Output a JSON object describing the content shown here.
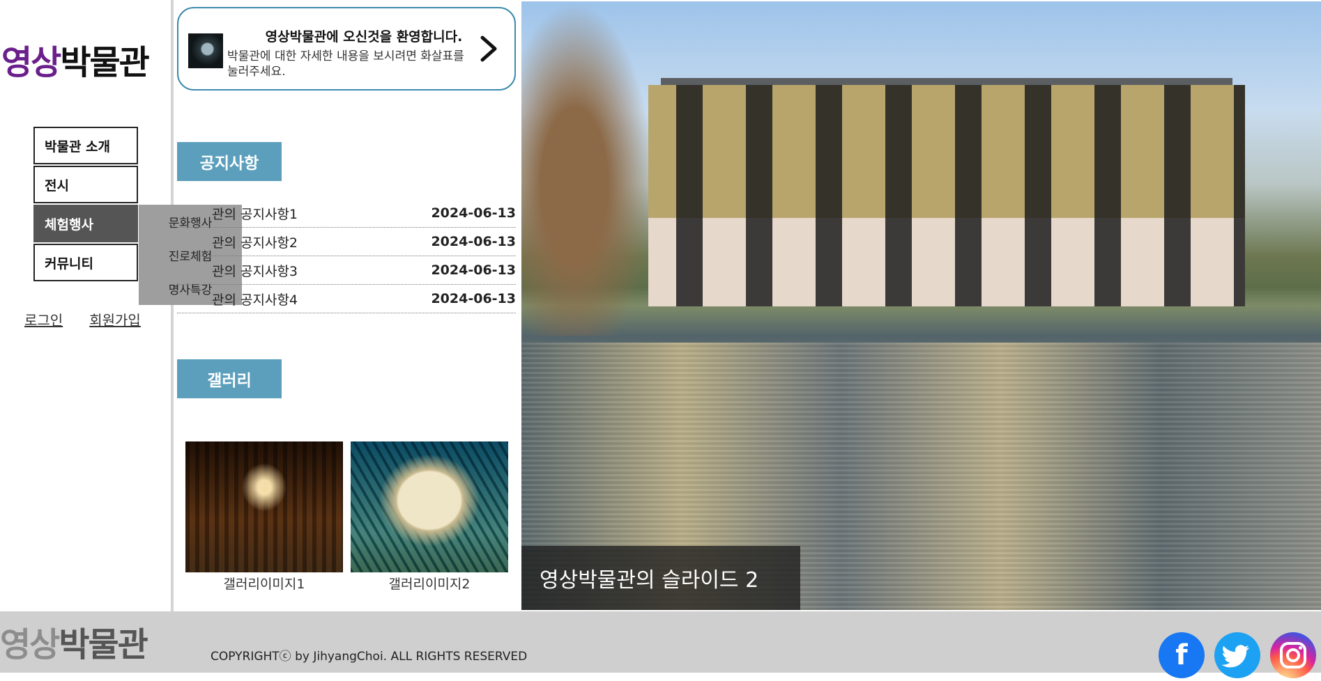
{
  "logo": {
    "part1": "영상",
    "part2": "박물관"
  },
  "nav": {
    "items": [
      {
        "label": "박물관 소개"
      },
      {
        "label": "전시"
      },
      {
        "label": "체험행사"
      },
      {
        "label": "커뮤니티"
      }
    ],
    "active_index": 2,
    "submenu": [
      {
        "label": "문화행사"
      },
      {
        "label": "진로체험"
      },
      {
        "label": "명사특강"
      }
    ]
  },
  "auth": {
    "login": "로그인",
    "signup": "회원가입"
  },
  "welcome": {
    "title": "영상박물관에 오신것을 환영합니다.",
    "desc": "박물관에 대한 자세한 내용을 보시려면 화살표를 눌러주세요.",
    "arrow_icon": "chevron-right-icon"
  },
  "notices": {
    "heading": "공지사항",
    "items": [
      {
        "title": "관의 공지사항1",
        "date": "2024-06-13"
      },
      {
        "title": "관의 공지사항2",
        "date": "2024-06-13"
      },
      {
        "title": "관의 공지사항3",
        "date": "2024-06-13"
      },
      {
        "title": "관의 공지사항4",
        "date": "2024-06-13"
      }
    ]
  },
  "gallery": {
    "heading": "갤러리",
    "items": [
      {
        "caption": "갤러리이미지1"
      },
      {
        "caption": "갤러리이미지2"
      }
    ]
  },
  "hero": {
    "caption": "영상박물관의 슬라이드 2"
  },
  "footer": {
    "logo_part1": "영상",
    "logo_part2": "박물관",
    "copyright": "COPYRIGHTⓒ by JihyangChoi. ALL RIGHTS RESERVED",
    "social": [
      {
        "name": "facebook-icon"
      },
      {
        "name": "twitter-icon"
      },
      {
        "name": "instagram-icon"
      }
    ]
  },
  "colors": {
    "accent": "#5b9fbd",
    "logo_purple": "#6a1f8a",
    "footer_bg": "#cfcfcf"
  }
}
